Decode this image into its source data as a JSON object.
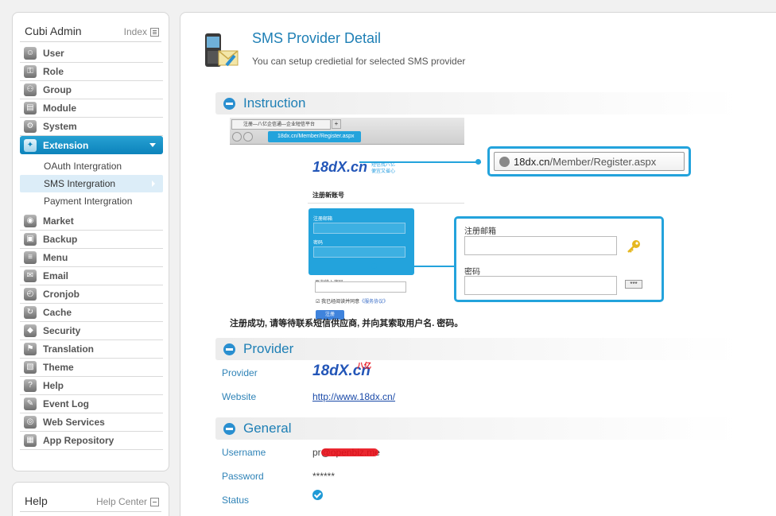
{
  "sidebar": {
    "title": "Cubi Admin",
    "index_label": "Index",
    "items": [
      {
        "label": "User",
        "icon": "user-icon"
      },
      {
        "label": "Role",
        "icon": "key-icon"
      },
      {
        "label": "Group",
        "icon": "group-icon"
      },
      {
        "label": "Module",
        "icon": "module-icon"
      },
      {
        "label": "System",
        "icon": "gear-icon"
      },
      {
        "label": "Extension",
        "icon": "puzzle-icon",
        "active": true
      },
      {
        "label": "Market",
        "icon": "market-icon"
      },
      {
        "label": "Backup",
        "icon": "backup-icon"
      },
      {
        "label": "Menu",
        "icon": "menu-icon"
      },
      {
        "label": "Email",
        "icon": "email-icon"
      },
      {
        "label": "Cronjob",
        "icon": "clock-icon"
      },
      {
        "label": "Cache",
        "icon": "cache-icon"
      },
      {
        "label": "Security",
        "icon": "shield-icon"
      },
      {
        "label": "Translation",
        "icon": "translation-icon"
      },
      {
        "label": "Theme",
        "icon": "theme-icon"
      },
      {
        "label": "Help",
        "icon": "help-icon"
      },
      {
        "label": "Event Log",
        "icon": "event-log-icon"
      },
      {
        "label": "Web Services",
        "icon": "globe-icon"
      },
      {
        "label": "App Repository",
        "icon": "app-repository-icon"
      }
    ],
    "subitems": [
      {
        "label": "OAuth Intergration"
      },
      {
        "label": "SMS Intergration",
        "selected": true
      },
      {
        "label": "Payment Intergration"
      }
    ]
  },
  "help_panel": {
    "title": "Help",
    "link_label": "Help Center"
  },
  "page": {
    "title": "SMS Provider Detail",
    "subtitle": "You can setup credietial for selected SMS provider"
  },
  "instruction": {
    "title": "Instruction",
    "browser_tab": "注册—八亿企信通—企业短信平台",
    "browser_address": "18dx.cn/Member/Register.aspx",
    "logo_text": "18dX.cn",
    "logo_tagline_1": "短信找八亿",
    "logo_tagline_2": "便宜又省心",
    "register_title": "注册新账号",
    "form_email_label": "注册邮箱",
    "form_password_label": "密码",
    "form_repeat_label": "再次输入密码",
    "agree_text": "我已经阅读并同意",
    "agree_link": "《服务协议》",
    "register_button": "注册",
    "zoom_url_domain": "18dx.cn",
    "zoom_url_path": "/Member/Register.aspx",
    "zoom_email_label": "注册邮箱",
    "zoom_password_label": "密码",
    "password_stars": "***",
    "caption": "注册成功, 请等待联系短信供应商, 并向其索取用户名. 密码。"
  },
  "provider": {
    "title": "Provider",
    "provider_label": "Provider",
    "provider_logo_text": "18dX.cn",
    "provider_logo_cn": "八亿",
    "website_label": "Website",
    "website_value": "http://www.18dx.cn/"
  },
  "general": {
    "title": "General",
    "username_label": "Username",
    "username_value": "pr@openbiz.me",
    "password_label": "Password",
    "password_value": "******",
    "status_label": "Status"
  },
  "colors": {
    "accent": "#0c83bb",
    "link": "#1a4aa8",
    "highlight": "#23a3dc"
  }
}
